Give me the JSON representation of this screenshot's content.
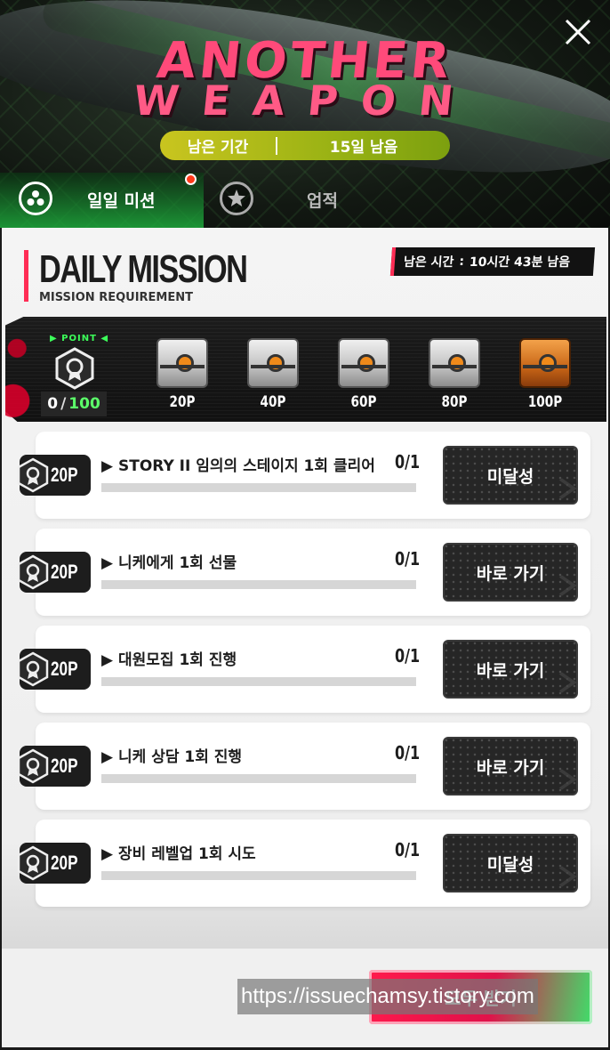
{
  "event": {
    "title_line1": "ANOTHER",
    "title_line2": "WEAPON",
    "period_label": "남은 기간",
    "period_value": "15일 남음"
  },
  "tabs": [
    {
      "label": "일일 미션",
      "active": true,
      "icon": "dots-circle-icon",
      "has_notification": true
    },
    {
      "label": "업적",
      "active": false,
      "icon": "star-circle-icon",
      "has_notification": false
    }
  ],
  "header": {
    "title": "DAILY MISSION",
    "subtitle": "MISSION REQUIREMENT",
    "timer_label": "남은 시간",
    "timer_separator": ":",
    "timer_value": "10시간 43분 남음"
  },
  "progress": {
    "tag": "▶ POINT ◀",
    "current": "0",
    "separator": "/",
    "max": "100",
    "rewards": [
      {
        "label": "20P",
        "chest": "silver"
      },
      {
        "label": "40P",
        "chest": "silver"
      },
      {
        "label": "60P",
        "chest": "silver"
      },
      {
        "label": "80P",
        "chest": "silver"
      },
      {
        "label": "100P",
        "chest": "gold"
      }
    ]
  },
  "missions": [
    {
      "points": "20P",
      "title": "▶ STORY II 임의의 스테이지 1회 클리어",
      "count": "0/1",
      "progress": 0,
      "button": "미달성"
    },
    {
      "points": "20P",
      "title": "▶ 니케에게 1회 선물",
      "count": "0/1",
      "progress": 0,
      "button": "바로 가기"
    },
    {
      "points": "20P",
      "title": "▶ 대원모집 1회 진행",
      "count": "0/1",
      "progress": 0,
      "button": "바로 가기"
    },
    {
      "points": "20P",
      "title": "▶ 니케 상담 1회 진행",
      "count": "0/1",
      "progress": 0,
      "button": "바로 가기"
    },
    {
      "points": "20P",
      "title": "▶ 장비 레벨업 1회 시도",
      "count": "0/1",
      "progress": 0,
      "button": "미달성"
    }
  ],
  "footer": {
    "claim_button": "모두 받기",
    "watermark": "https://issuechamsy.tistory.com"
  },
  "colors": {
    "accent_red": "#ff2d55",
    "accent_green": "#2fd84a",
    "point_green": "#5cff6a",
    "period_pill": "#a8b816"
  }
}
